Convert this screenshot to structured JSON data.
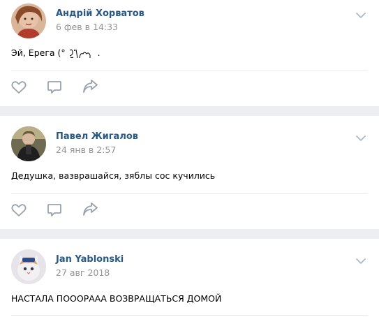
{
  "posts": [
    {
      "author": "Андрій Хорватов",
      "date": "6 фев в 14:33",
      "text": "Эй, Ерега (°",
      "text_tail": ".",
      "avatar_icon": "avatar-girl-photo"
    },
    {
      "author": "Павел Жигалов",
      "date": "24 янв в 2:57",
      "text": "Дедушка, вазврашайся, зяблы сос кучились",
      "avatar_icon": "avatar-mirror-selfie"
    },
    {
      "author": "Jan Yablonski",
      "date": "27 авг 2018",
      "text": "НАСТАЛА ПОООРААА ВОЗВРАЩАТЬСЯ ДОМОЙ",
      "avatar_icon": "avatar-cat"
    }
  ],
  "icons": {
    "like": "heart-icon",
    "comment": "comment-icon",
    "share": "share-icon",
    "menu": "chevron-down-icon"
  },
  "colors": {
    "author": "#2a5885",
    "date": "#939393",
    "icon": "#99a2ad",
    "background": "#edeef0",
    "card": "#ffffff"
  }
}
